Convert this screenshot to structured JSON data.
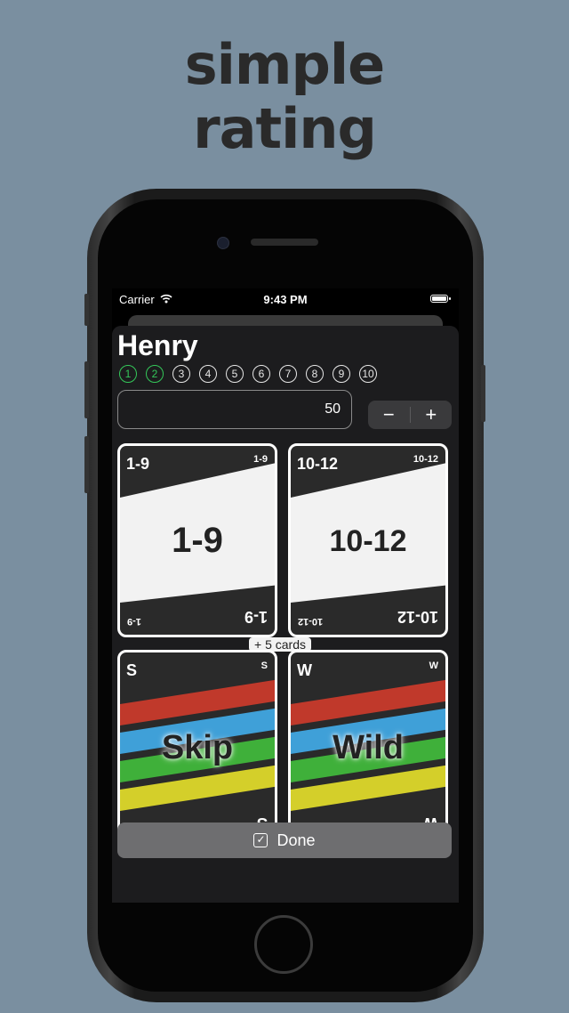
{
  "headline": {
    "line1": "simple",
    "line2": "rating"
  },
  "status_bar": {
    "carrier": "Carrier",
    "time": "9:43 PM"
  },
  "player": {
    "name": "Henry"
  },
  "rating": {
    "options": [
      "1",
      "2",
      "3",
      "4",
      "5",
      "6",
      "7",
      "8",
      "9",
      "10"
    ],
    "selected": 2
  },
  "score": {
    "value": "50"
  },
  "stepper": {
    "minus": "−",
    "plus": "+"
  },
  "cards": [
    {
      "corner": "1-9",
      "center": "1-9"
    },
    {
      "corner": "10-12",
      "center": "10-12"
    },
    {
      "corner": "S",
      "center": "Skip"
    },
    {
      "corner": "W",
      "center": "Wild"
    }
  ],
  "more_cards": "+ 5 cards",
  "done": {
    "check": "✓",
    "label": "Done"
  },
  "stripe_colors": [
    "#c0392b",
    "#3fa0d8",
    "#3fb03a",
    "#d4cf2a"
  ]
}
